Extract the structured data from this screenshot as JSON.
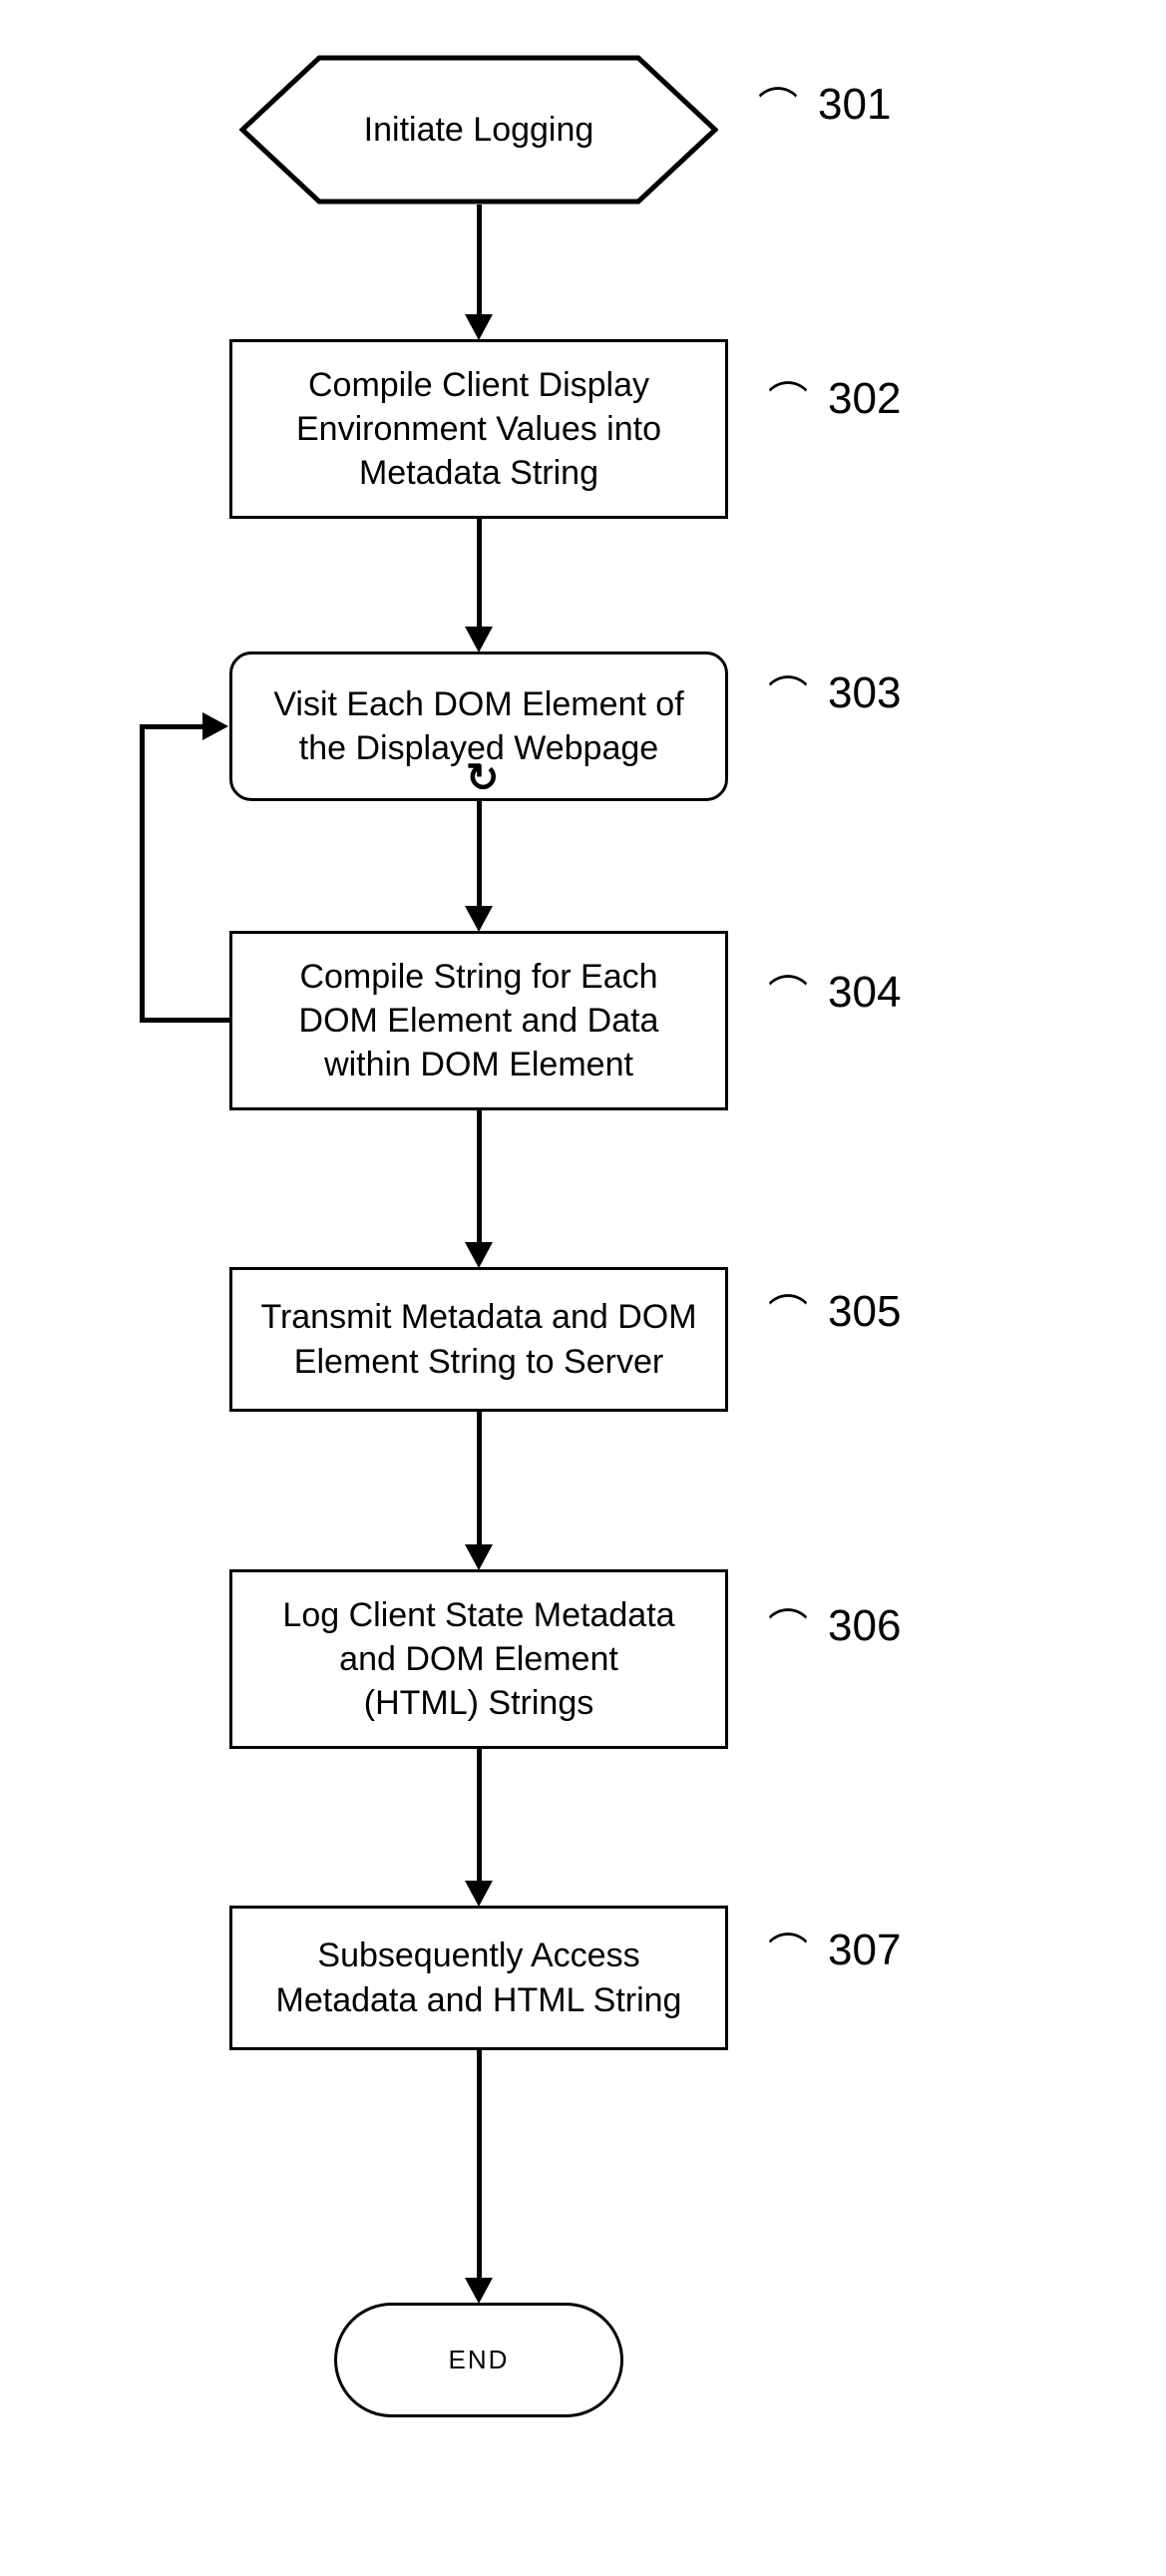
{
  "chart_data": {
    "type": "flowchart",
    "nodes": [
      {
        "id": "301",
        "shape": "hexagon",
        "text": "Initiate Logging"
      },
      {
        "id": "302",
        "shape": "rect",
        "text": "Compile Client Display Environment Values into Metadata String"
      },
      {
        "id": "303",
        "shape": "rounded-rect",
        "text": "Visit Each DOM Element of the Displayed Webpage",
        "self_loop": true
      },
      {
        "id": "304",
        "shape": "rect",
        "text": "Compile String for Each DOM Element and Data within DOM Element"
      },
      {
        "id": "305",
        "shape": "rect",
        "text": "Transmit Metadata and DOM Element String to Server"
      },
      {
        "id": "306",
        "shape": "rect",
        "text": "Log Client State Metadata and DOM Element (HTML) Strings"
      },
      {
        "id": "307",
        "shape": "rect",
        "text": "Subsequently Access Metadata and HTML String"
      },
      {
        "id": "end",
        "shape": "terminator",
        "text": "END"
      }
    ],
    "edges": [
      {
        "from": "301",
        "to": "302"
      },
      {
        "from": "302",
        "to": "303"
      },
      {
        "from": "303",
        "to": "304"
      },
      {
        "from": "304",
        "to": "303",
        "type": "loop-back"
      },
      {
        "from": "304",
        "to": "305"
      },
      {
        "from": "305",
        "to": "306"
      },
      {
        "from": "306",
        "to": "307"
      },
      {
        "from": "307",
        "to": "end"
      }
    ]
  },
  "labels": {
    "n301": "301",
    "n302": "302",
    "n303": "303",
    "n304": "304",
    "n305": "305",
    "n306": "306",
    "n307": "307"
  },
  "texts": {
    "n301": "Initiate Logging",
    "n302": "Compile Client Display\nEnvironment Values into\nMetadata String",
    "n303": "Visit Each DOM Element of\nthe Displayed Webpage",
    "n304": "Compile String for Each\nDOM Element and Data\nwithin DOM Element",
    "n305": "Transmit Metadata and DOM\nElement String to Server",
    "n306": "Log Client State Metadata\nand DOM Element\n(HTML) Strings",
    "n307": "Subsequently Access\nMetadata and HTML String",
    "end": "END"
  }
}
